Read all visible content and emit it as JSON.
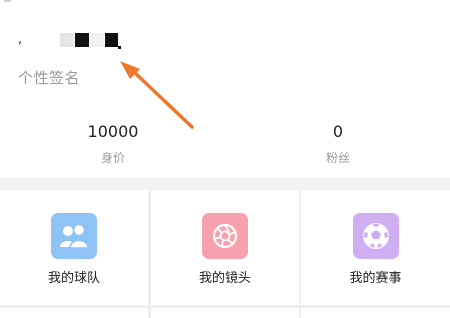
{
  "profile": {
    "name_prefix": ",",
    "bio": "个性签名",
    "annotation_color": "#f0782a"
  },
  "stats": [
    {
      "value": "10000",
      "label": "身价"
    },
    {
      "value": "0",
      "label": "粉丝"
    }
  ],
  "menu": [
    {
      "label": "我的球队",
      "icon": "team-icon",
      "color": "#8ec3f5"
    },
    {
      "label": "我的镜头",
      "icon": "camera-aperture-icon",
      "color": "#f7a1ad"
    },
    {
      "label": "我的赛事",
      "icon": "soccer-ball-icon",
      "color": "#cfaef2"
    }
  ]
}
